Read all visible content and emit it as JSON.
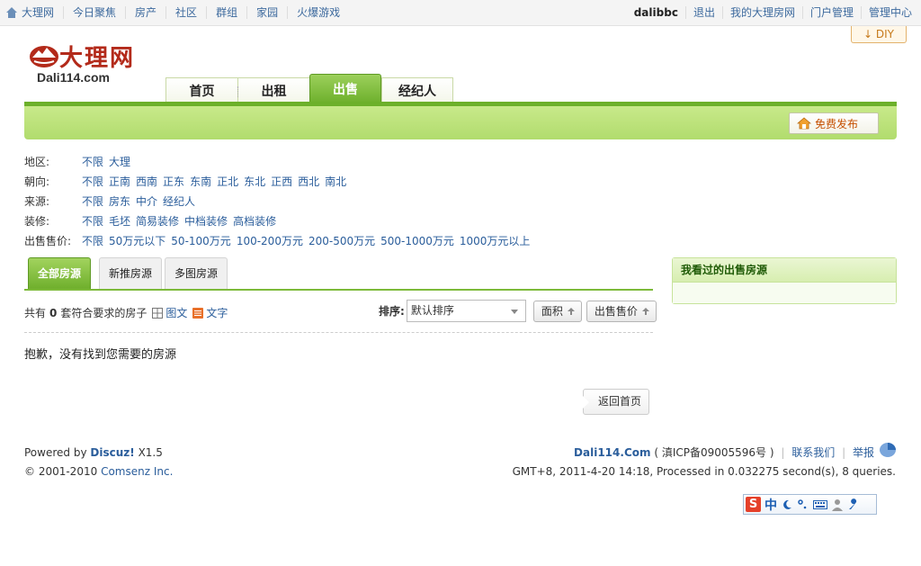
{
  "topbar": {
    "links": [
      "大理网",
      "今日聚焦",
      "房产",
      "社区",
      "群组",
      "家园",
      "火爆游戏"
    ],
    "user": "dalibbc",
    "right_links": [
      "退出",
      "我的大理房网",
      "门户管理",
      "管理中心"
    ]
  },
  "header": {
    "logo_cn": "大理网",
    "logo_en": "Dali114.com",
    "diy": "DIY",
    "nav": [
      "首页",
      "出租",
      "出售",
      "经纪人"
    ],
    "active_nav": "出售",
    "publish": "免费发布"
  },
  "filters": [
    {
      "label": "地区:",
      "options": [
        "不限",
        "大理"
      ]
    },
    {
      "label": "朝向:",
      "options": [
        "不限",
        "正南",
        "西南",
        "正东",
        "东南",
        "正北",
        "东北",
        "正西",
        "西北",
        "南北"
      ]
    },
    {
      "label": "来源:",
      "options": [
        "不限",
        "房东",
        "中介",
        "经纪人"
      ]
    },
    {
      "label": "装修:",
      "options": [
        "不限",
        "毛坯",
        "简易装修",
        "中档装修",
        "高档装修"
      ]
    },
    {
      "label": "出售售价:",
      "options": [
        "不限",
        "50万元以下",
        "50-100万元",
        "100-200万元",
        "200-500万元",
        "500-1000万元",
        "1000万元以上"
      ]
    }
  ],
  "list": {
    "tabs": [
      "全部房源",
      "新推房源",
      "多图房源"
    ],
    "count_prefix": "共有",
    "count": "0",
    "count_suffix": "套符合要求的房子",
    "view_pic": "图文",
    "view_text": "文字",
    "sort_label": "排序:",
    "sort_value": "默认排序",
    "sort_area": "面积",
    "sort_price": "出售售价",
    "empty_msg": "抱歉，没有找到您需要的房源",
    "back": "返回首页"
  },
  "sidebar": {
    "title": "我看过的出售房源"
  },
  "footer": {
    "powered_prefix": "Powered by",
    "powered_brand": "Discuz!",
    "powered_version": "X1.5",
    "copyright_prefix": "© 2001-2010",
    "copyright_corp": "Comsenz Inc.",
    "site": "Dali114.Com",
    "icp": "( 滇ICP备09005596号 )",
    "contact": "联系我们",
    "report": "举报",
    "stats": "GMT+8, 2011-4-20 14:18, Processed in 0.032275 second(s), 8 queries."
  },
  "ime": {
    "s": "S",
    "lang": "中"
  },
  "colors": {
    "accent_green": "#6cb02a",
    "link_blue": "#2a5d9b",
    "logo_red": "#b32a1a"
  }
}
